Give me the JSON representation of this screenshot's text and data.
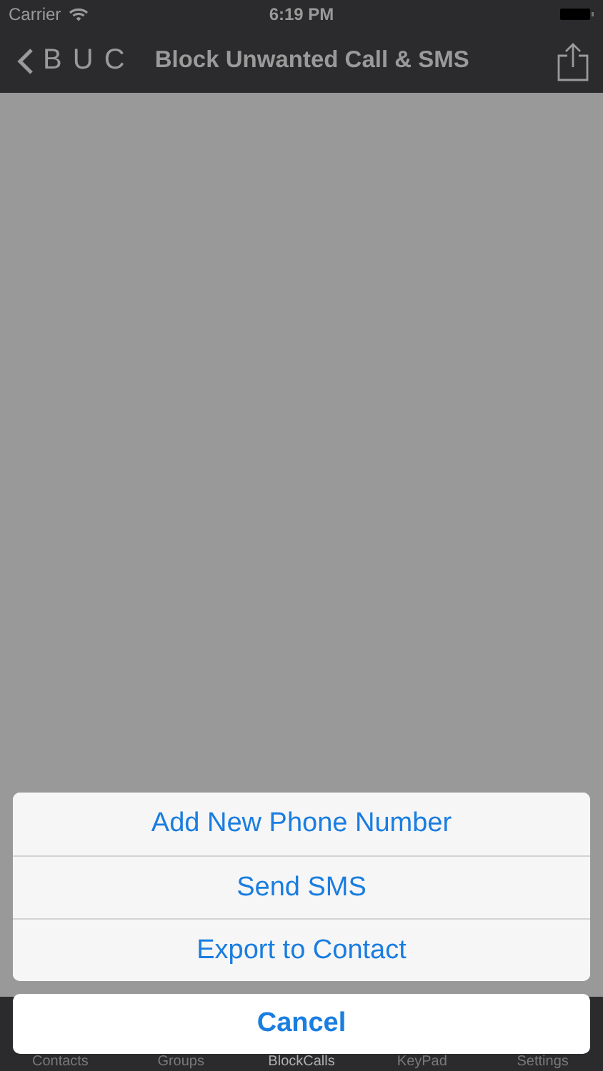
{
  "status_bar": {
    "carrier": "Carrier",
    "time": "6:19 PM"
  },
  "nav_bar": {
    "back_label": "B U C",
    "title": "Block Unwanted Call & SMS"
  },
  "tab_bar": {
    "tabs": [
      {
        "label": "Contacts",
        "selected": false
      },
      {
        "label": "Groups",
        "selected": false
      },
      {
        "label": "BlockCalls",
        "selected": true
      },
      {
        "label": "KeyPad",
        "selected": false
      },
      {
        "label": "Settings",
        "selected": false
      }
    ]
  },
  "action_sheet": {
    "actions": [
      "Add New Phone Number",
      "Send SMS",
      "Export to Contact"
    ],
    "cancel": "Cancel"
  }
}
